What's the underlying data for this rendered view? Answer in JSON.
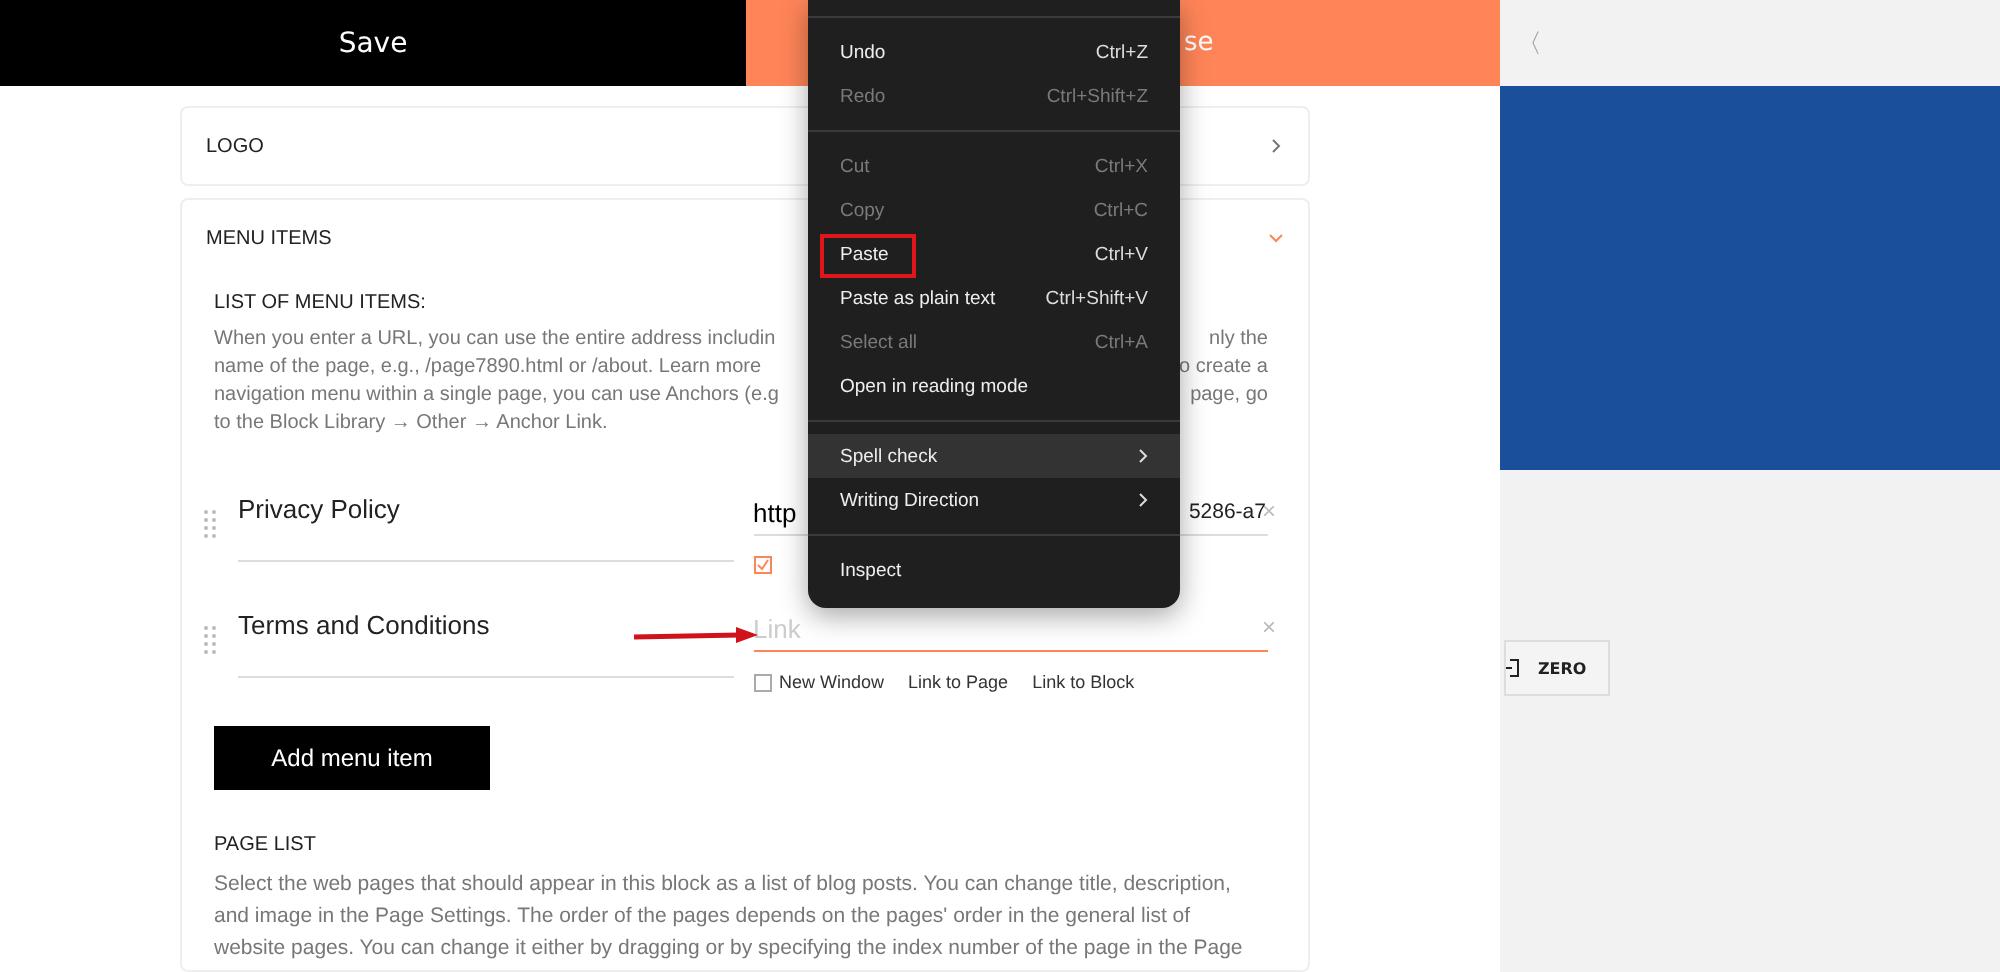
{
  "toolbar": {
    "save_label": "Save",
    "close_label_visible": "se",
    "collapse_glyph": "〈"
  },
  "logo_section": {
    "title": "LOGO",
    "expanded": false
  },
  "menu_items_section": {
    "title": "MENU ITEMS",
    "expanded": true,
    "subtitle": "LIST OF MENU ITEMS:",
    "help_lines": [
      {
        "left": "When you enter a URL, you can use the entire address includin",
        "right": "nly the"
      },
      {
        "left": "name of the page, e.g., /page7890.html or /about. Learn more",
        "right": "o create a"
      },
      {
        "left": "navigation menu within a single page, you can use Anchors (e.g",
        "right": "page, go"
      },
      {
        "left": "to the Block Library → Other → Anchor Link."
      }
    ],
    "items": [
      {
        "title": "Privacy Policy",
        "link_start": "http",
        "link_end": "5286-a7",
        "focused": false,
        "new_window": true
      },
      {
        "title": "Terms and Conditions",
        "placeholder": "Link",
        "focused": true,
        "new_window": false,
        "new_window_label": "New Window",
        "options": [
          "Link to Page",
          "Link to Block"
        ]
      }
    ],
    "add_button": "Add menu item"
  },
  "page_list": {
    "title": "PAGE LIST",
    "lines": [
      "Select the web pages that should appear in this block as a list of blog posts. You can change title, description,",
      "and image in the Page Settings. The order of the pages depends on the pages' order in the general list of",
      "website pages. You can change it either by dragging or by specifying the index number of the page in the Page"
    ]
  },
  "preview": {
    "zero_label": "ZERO"
  },
  "context_menu": [
    {
      "kind": "separator"
    },
    {
      "kind": "item",
      "label": "Undo",
      "shortcut": "Ctrl+Z",
      "disabled": false,
      "highlighted": false,
      "submenu": false,
      "annotated": false
    },
    {
      "kind": "item",
      "label": "Redo",
      "shortcut": "Ctrl+Shift+Z",
      "disabled": true,
      "highlighted": false,
      "submenu": false,
      "annotated": false
    },
    {
      "kind": "separator"
    },
    {
      "kind": "item",
      "label": "Cut",
      "shortcut": "Ctrl+X",
      "disabled": true,
      "highlighted": false,
      "submenu": false,
      "annotated": false
    },
    {
      "kind": "item",
      "label": "Copy",
      "shortcut": "Ctrl+C",
      "disabled": true,
      "highlighted": false,
      "submenu": false,
      "annotated": false
    },
    {
      "kind": "item",
      "label": "Paste",
      "shortcut": "Ctrl+V",
      "disabled": false,
      "highlighted": false,
      "submenu": false,
      "annotated": true
    },
    {
      "kind": "item",
      "label": "Paste as plain text",
      "shortcut": "Ctrl+Shift+V",
      "disabled": false,
      "highlighted": false,
      "submenu": false,
      "annotated": false
    },
    {
      "kind": "item",
      "label": "Select all",
      "shortcut": "Ctrl+A",
      "disabled": true,
      "highlighted": false,
      "submenu": false,
      "annotated": false
    },
    {
      "kind": "item",
      "label": "Open in reading mode",
      "disabled": false,
      "highlighted": false,
      "submenu": false,
      "annotated": false
    },
    {
      "kind": "separator"
    },
    {
      "kind": "item",
      "label": "Spell check",
      "disabled": false,
      "highlighted": true,
      "submenu": true,
      "annotated": false
    },
    {
      "kind": "item",
      "label": "Writing Direction",
      "disabled": false,
      "highlighted": false,
      "submenu": true,
      "annotated": false
    },
    {
      "kind": "separator"
    },
    {
      "kind": "item",
      "label": "Inspect",
      "disabled": false,
      "highlighted": false,
      "submenu": false,
      "annotated": false
    }
  ]
}
